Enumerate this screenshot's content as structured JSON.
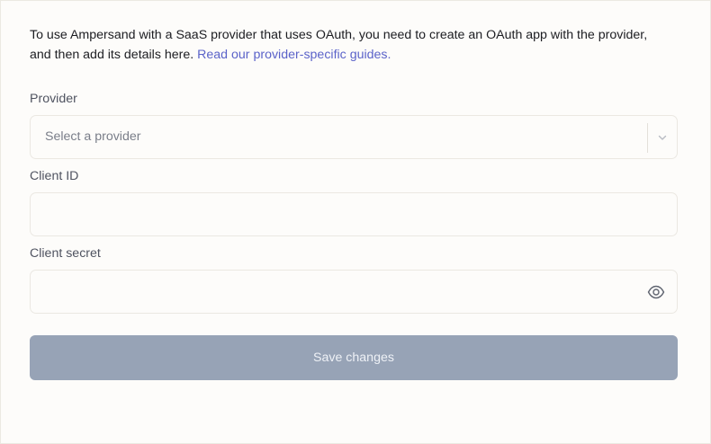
{
  "intro": {
    "text": "To use Ampersand with a SaaS provider that uses OAuth, you need to create an OAuth app with the provider, and then add its details here. ",
    "link_text": "Read our provider-specific guides."
  },
  "provider": {
    "label": "Provider",
    "placeholder": "Select a provider",
    "selected_value": ""
  },
  "client_id": {
    "label": "Client ID",
    "value": ""
  },
  "client_secret": {
    "label": "Client secret",
    "value": "",
    "visibility_icon": "eye-icon"
  },
  "actions": {
    "save_label": "Save changes"
  },
  "colors": {
    "link": "#5b63c9",
    "button_disabled": "#97a3b6",
    "background": "#fdfcfa"
  }
}
